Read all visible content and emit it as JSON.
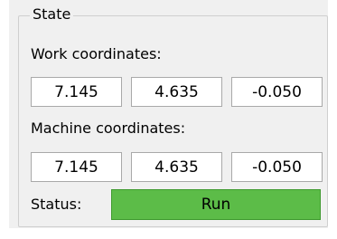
{
  "state": {
    "group_title": "State",
    "work_label": "Work coordinates:",
    "work": {
      "x": "7.145",
      "y": "4.635",
      "z": "-0.050"
    },
    "machine_label": "Machine coordinates:",
    "machine": {
      "x": "7.145",
      "y": "4.635",
      "z": "-0.050"
    },
    "status_label": "Status:",
    "status_value": "Run",
    "status_color": "#5cbc48"
  }
}
